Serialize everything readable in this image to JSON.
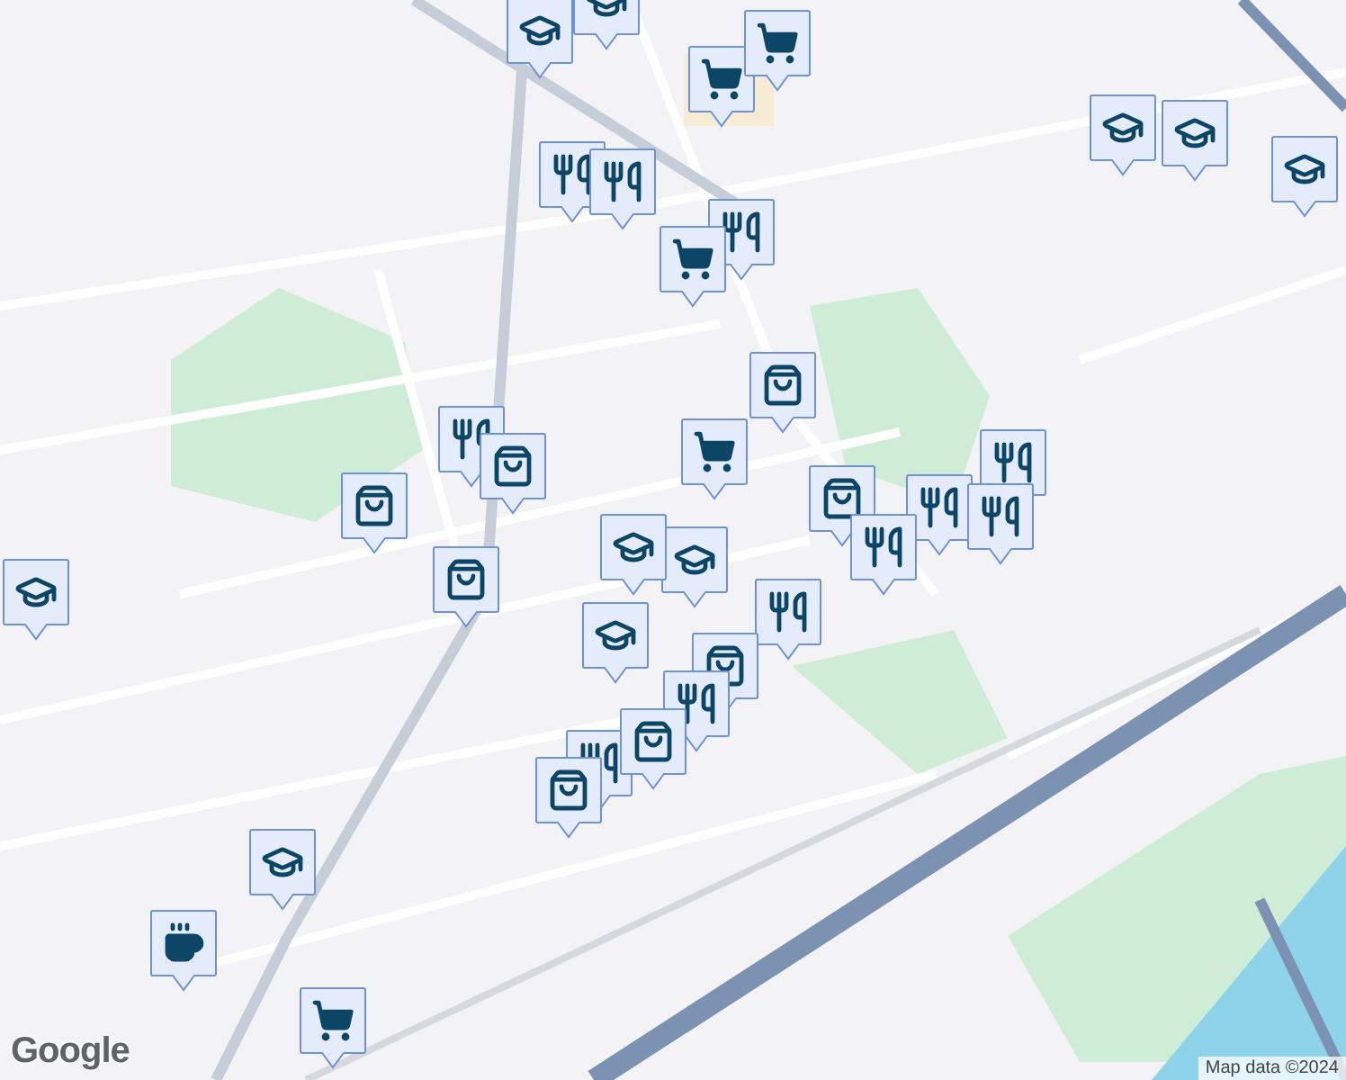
{
  "map": {
    "markers": [
      {
        "kind": "school"
      },
      {
        "kind": "school"
      },
      {
        "kind": "cart"
      },
      {
        "kind": "cart"
      },
      {
        "kind": "restaurant"
      },
      {
        "kind": "restaurant"
      },
      {
        "kind": "restaurant"
      },
      {
        "kind": "cart"
      },
      {
        "kind": "school"
      },
      {
        "kind": "school"
      },
      {
        "kind": "school"
      },
      {
        "kind": "shop"
      },
      {
        "kind": "restaurant"
      },
      {
        "kind": "shop"
      },
      {
        "kind": "cart"
      },
      {
        "kind": "shop"
      },
      {
        "kind": "restaurant"
      },
      {
        "kind": "shop"
      },
      {
        "kind": "restaurant"
      },
      {
        "kind": "restaurant"
      },
      {
        "kind": "restaurant"
      },
      {
        "kind": "school"
      },
      {
        "kind": "school"
      },
      {
        "kind": "shop"
      },
      {
        "kind": "school"
      },
      {
        "kind": "restaurant"
      },
      {
        "kind": "school"
      },
      {
        "kind": "shop"
      },
      {
        "kind": "restaurant"
      },
      {
        "kind": "restaurant"
      },
      {
        "kind": "shop"
      },
      {
        "kind": "shop"
      },
      {
        "kind": "school"
      },
      {
        "kind": "cafe"
      },
      {
        "kind": "cart"
      }
    ]
  },
  "logo": "Google",
  "attribution": "Map data ©2024"
}
